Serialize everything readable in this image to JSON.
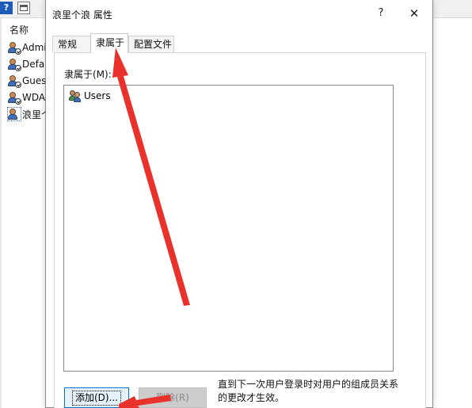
{
  "background": {
    "list_header": "名称",
    "users": [
      "Admi",
      "Defau",
      "Gues",
      "WDA",
      "浪里个"
    ]
  },
  "dialog": {
    "title": "浪里个浪 属性",
    "help": "?",
    "close": "✕",
    "tabs": {
      "general": "常规",
      "member_of": "隶属于",
      "profile": "配置文件"
    },
    "member_of_label": "隶属于(M):",
    "groups": [
      "Users"
    ],
    "add_button": "添加(D)...",
    "remove_button": "删除(R)",
    "note": "直到下一次用户登录时对用户的组成员关系的更改才生效。"
  },
  "colors": {
    "annotation": "#e8322b",
    "focus_border": "#0078d7"
  }
}
